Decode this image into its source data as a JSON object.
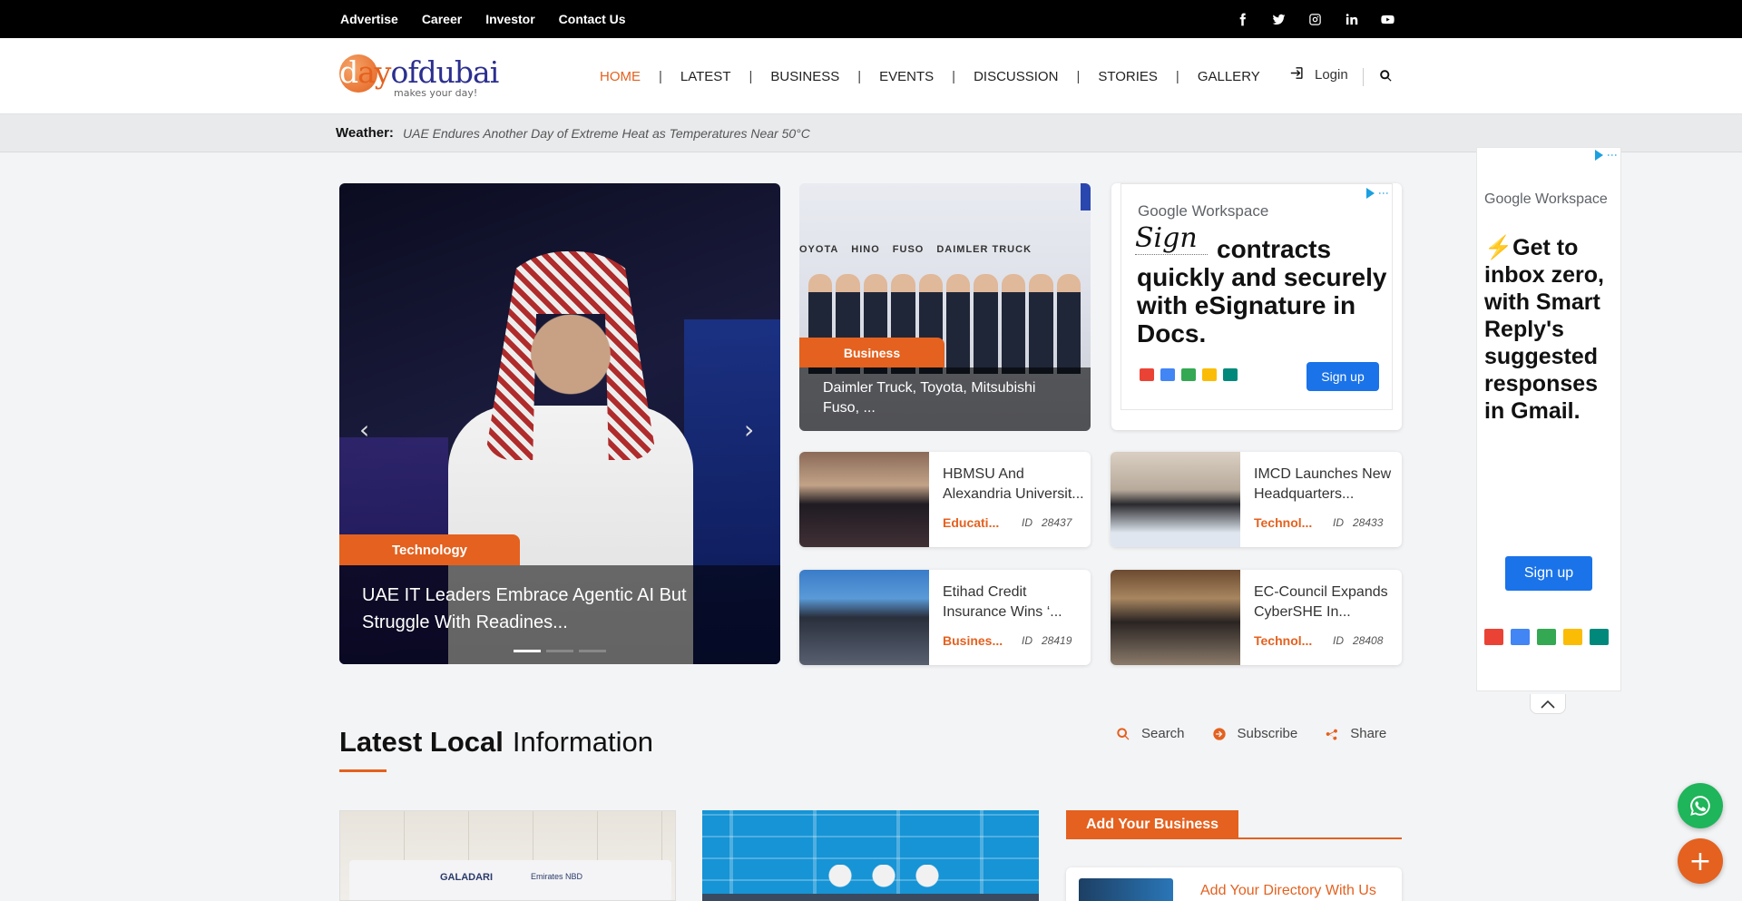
{
  "topbar": {
    "links": [
      "Advertise",
      "Career",
      "Investor",
      "Contact Us"
    ],
    "social_icons": [
      "facebook-icon",
      "twitter-icon",
      "instagram-icon",
      "linkedin-icon",
      "youtube-icon"
    ]
  },
  "header": {
    "logo_word": "dayofdubai",
    "logo_parts": [
      "d",
      "ay",
      "ofdubai"
    ],
    "logo_tagline": "makes your day!",
    "nav": [
      "HOME",
      "LATEST",
      "BUSINESS",
      "EVENTS",
      "DISCUSSION",
      "STORIES",
      "GALLERY"
    ],
    "active_nav": "HOME",
    "login_label": "Login"
  },
  "weather": {
    "label": "Weather:",
    "text": "UAE Endures Another Day of Extreme Heat as Temperatures Near 50°C"
  },
  "slider": {
    "category": "Technology",
    "title": "UAE IT Leaders Embrace Agentic AI But Struggle With Readines...",
    "slide_count": 3,
    "active_slide": 1
  },
  "featured": {
    "brands": [
      "OYOTA",
      "HINO",
      "FUSO",
      "DAIMLER TRUCK"
    ],
    "category": "Business",
    "title": "Daimler Truck, Toyota, Mitsubishi Fuso, ..."
  },
  "news_cards": [
    {
      "title": "HBMSU And Alexandria Universit...",
      "category": "Educati...",
      "id_label": "ID",
      "id": "28437"
    },
    {
      "title": "IMCD Launches New Headquarters...",
      "category": "Technol...",
      "id_label": "ID",
      "id": "28433"
    },
    {
      "title": "Etihad Credit Insurance Wins ‘...",
      "category": "Busines...",
      "id_label": "ID",
      "id": "28419"
    },
    {
      "title": "EC-Council Expands CyberSHE In...",
      "category": "Technol...",
      "id_label": "ID",
      "id": "28408"
    }
  ],
  "ad_main": {
    "brand_google": "Google",
    "brand_workspace": "Workspace",
    "sign_word": "Sign",
    "headline": "contracts quickly and securely with eSignature in Docs.",
    "button": "Sign up"
  },
  "ad_side": {
    "brand_google": "Google",
    "brand_workspace": "Workspace",
    "headline": "Get to inbox zero, with Smart Reply's suggested responses in Gmail.",
    "button": "Sign up"
  },
  "section": {
    "title_bold": "Latest Local",
    "title_light": "Information",
    "tools": [
      "Search",
      "Subscribe",
      "Share"
    ]
  },
  "bottom": {
    "card1_brand": "GALADARI",
    "card1_brand2": "Emirates NBD",
    "add_business_tab": "Add Your Business",
    "directory_title": "Add Your Directory With Us"
  },
  "colors": {
    "accent": "#e4611f",
    "brand_blue": "#2b2f8f",
    "google_blue": "#1a73e8",
    "whatsapp_green": "#1fb55a"
  }
}
